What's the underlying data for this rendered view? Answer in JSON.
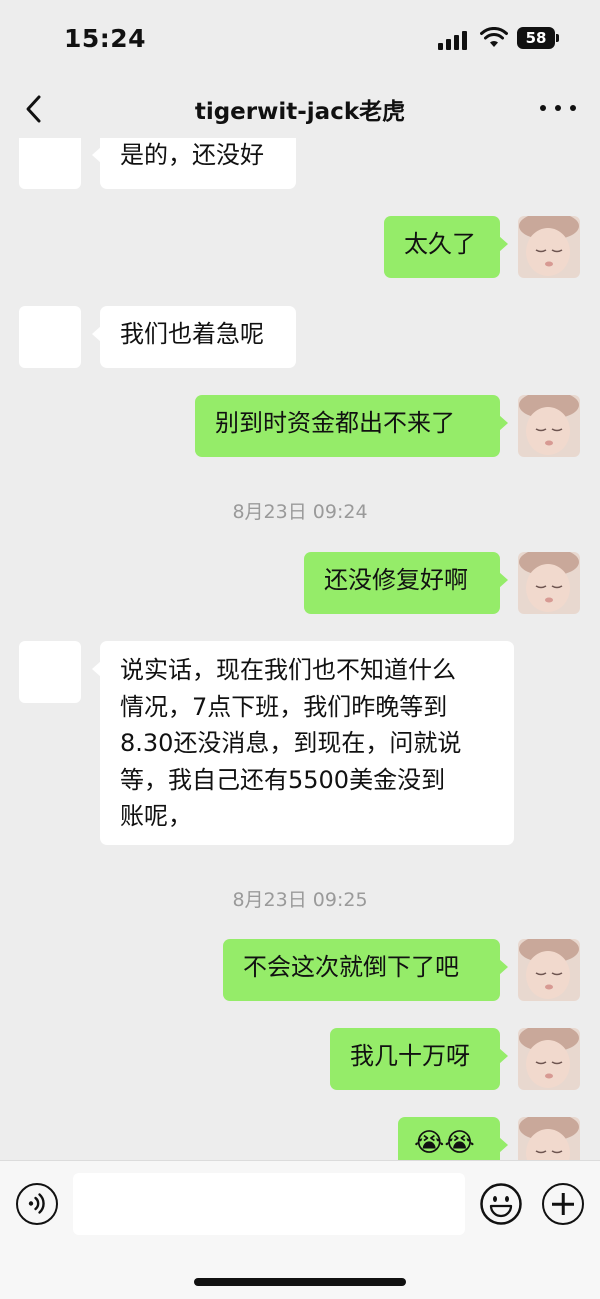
{
  "status": {
    "time": "15:24",
    "battery": "58"
  },
  "nav": {
    "title": "tigerwit-jack老虎",
    "back_icon": "chevron-left-icon",
    "more_icon": "ellipsis-icon"
  },
  "messages": [
    {
      "side": "in",
      "text": "是的，还没好"
    },
    {
      "side": "out",
      "text": "太久了"
    },
    {
      "side": "in",
      "text": "我们也着急呢"
    },
    {
      "side": "out",
      "text": "别到时资金都出不来了"
    },
    {
      "timestamp": "8月23日 09:24"
    },
    {
      "side": "out",
      "text": "还没修复好啊"
    },
    {
      "side": "in",
      "lines": [
        "说实话，现在我们也不知道什么",
        "情况，7点下班，我们昨晚等到",
        "8.30还没消息，到现在，问就说",
        "等，我自己还有5500美金没到",
        "账呢，"
      ]
    },
    {
      "timestamp": "8月23日 09:25"
    },
    {
      "side": "out",
      "text": "不会这次就倒下了吧"
    },
    {
      "side": "out",
      "text": "我几十万呀"
    },
    {
      "side": "out",
      "text": "😭😭"
    }
  ],
  "input": {
    "voice_icon": "voice-icon",
    "emoji_icon": "emoji-icon",
    "plus_icon": "plus-icon"
  }
}
